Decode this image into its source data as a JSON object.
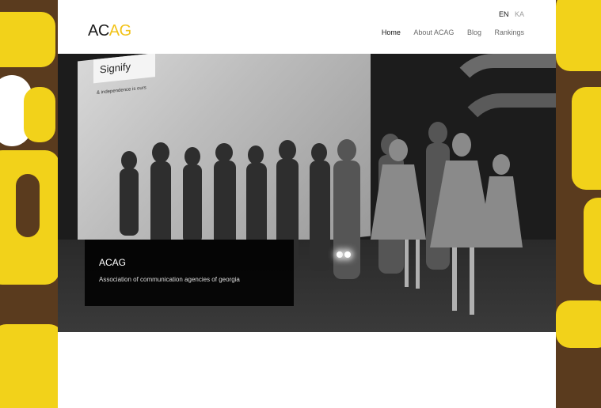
{
  "header": {
    "logo": {
      "part1": "AC",
      "part2": "AG"
    },
    "languages": [
      {
        "label": "EN",
        "active": true
      },
      {
        "label": "KA",
        "active": false
      }
    ],
    "nav": [
      {
        "label": "Home",
        "active": true
      },
      {
        "label": "About ACAG",
        "active": false
      },
      {
        "label": "Blog",
        "active": false
      },
      {
        "label": "Rankings",
        "active": false
      }
    ]
  },
  "hero": {
    "screen_sign": "Signify",
    "screen_tagline": "& independence is ours",
    "caption": {
      "title": "ACAG",
      "subtitle": "Association of communication agencies of georgia"
    }
  },
  "colors": {
    "accent": "#f2c31a",
    "backdrop_brown": "#5a3b1e",
    "backdrop_yellow": "#f2d21a"
  }
}
